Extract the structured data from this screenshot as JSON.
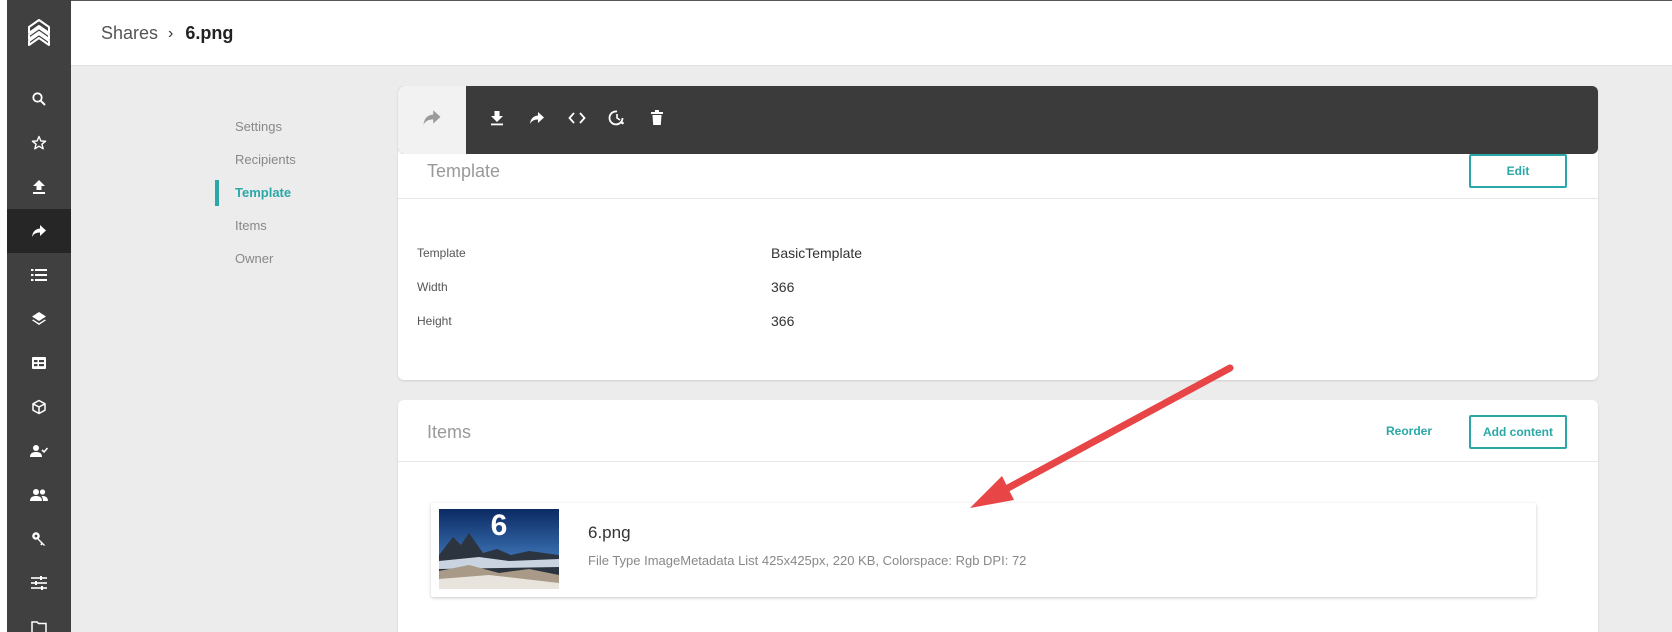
{
  "breadcrumb": {
    "parent": "Shares",
    "separator": "›",
    "current": "6.png"
  },
  "sidebar": {
    "logo_icon": "picturepark-logo-icon",
    "items": [
      {
        "icon": "search-icon"
      },
      {
        "icon": "star-icon"
      },
      {
        "icon": "upload-icon"
      },
      {
        "icon": "share-icon",
        "active": true
      },
      {
        "icon": "list-icon"
      },
      {
        "icon": "layers-icon"
      },
      {
        "icon": "table-icon"
      },
      {
        "icon": "cube-icon"
      },
      {
        "icon": "user-check-icon"
      },
      {
        "icon": "people-icon"
      },
      {
        "icon": "key-icon"
      },
      {
        "icon": "sliders-icon"
      },
      {
        "icon": "folder-icon"
      }
    ]
  },
  "section_nav": {
    "items": [
      {
        "label": "Settings"
      },
      {
        "label": "Recipients"
      },
      {
        "label": "Template",
        "active": true
      },
      {
        "label": "Items"
      },
      {
        "label": "Owner"
      }
    ]
  },
  "toolbar": {
    "buttons": [
      "download-icon",
      "share-icon",
      "code-icon",
      "history-icon",
      "delete-icon"
    ]
  },
  "template_card": {
    "title": "Template",
    "edit_label": "Edit",
    "rows": [
      {
        "label": "Template",
        "value": "BasicTemplate"
      },
      {
        "label": "Width",
        "value": "366"
      },
      {
        "label": "Height",
        "value": "366"
      }
    ]
  },
  "items_card": {
    "title": "Items",
    "reorder_label": "Reorder",
    "add_label": "Add content",
    "item": {
      "thumbnail_text": "6",
      "name": "6.png",
      "meta": "File Type ImageMetadata List 425x425px, 220 KB, Colorspace: Rgb DPI: 72"
    }
  },
  "colors": {
    "accent": "#2aa8a8",
    "sidebar_bg": "#404040",
    "toolbar_bg": "#3b3b3b",
    "annotation_arrow": "#e84646"
  }
}
